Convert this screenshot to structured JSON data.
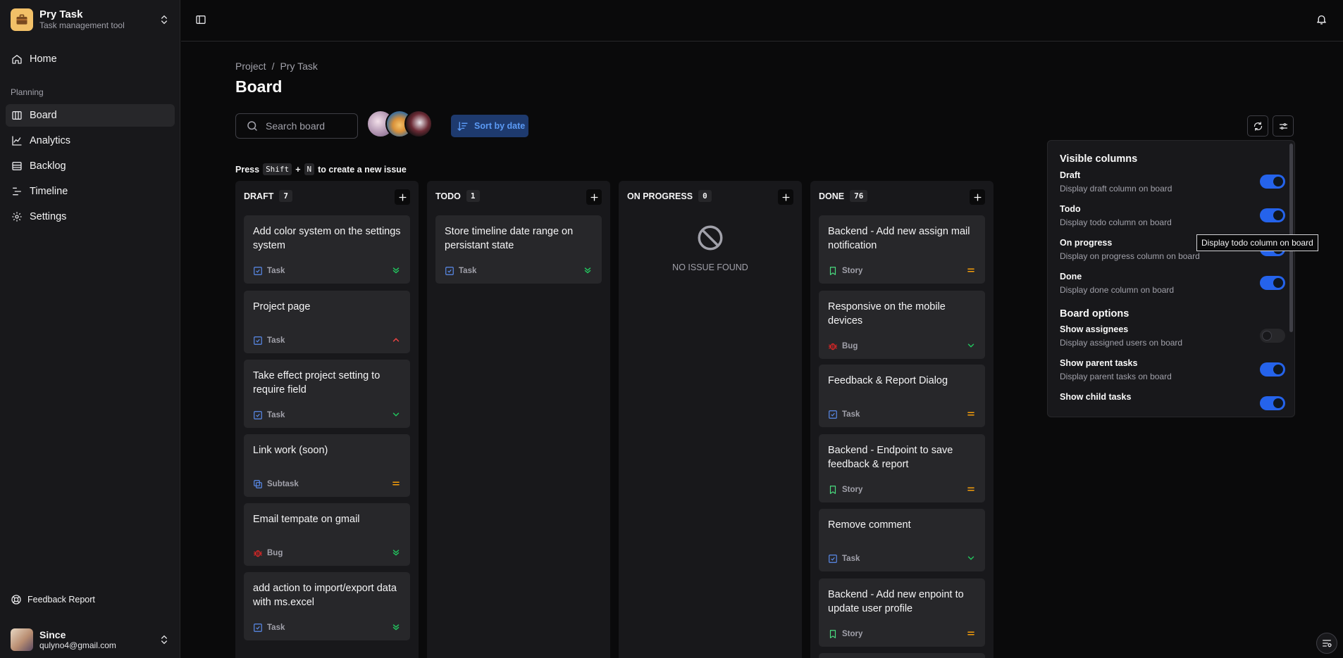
{
  "sidebar": {
    "brand": {
      "name": "Pry Task",
      "subtitle": "Task management tool"
    },
    "home": "Home",
    "section": "Planning",
    "items": [
      {
        "label": "Board",
        "icon": "board-icon",
        "active": true
      },
      {
        "label": "Analytics",
        "icon": "chart-icon"
      },
      {
        "label": "Backlog",
        "icon": "backlog-icon"
      },
      {
        "label": "Timeline",
        "icon": "timeline-icon"
      },
      {
        "label": "Settings",
        "icon": "gear-icon"
      }
    ],
    "feedback": "Feedback Report",
    "user": {
      "name": "Since",
      "email": "qulyno4@gmail.com"
    }
  },
  "breadcrumb": {
    "project": "Project",
    "separator": "/",
    "current": "Pry Task"
  },
  "page": {
    "title": "Board"
  },
  "search": {
    "placeholder": "Search board"
  },
  "sort": {
    "label": "Sort by date"
  },
  "hint": {
    "press": "Press",
    "key1": "Shift",
    "plus": "+",
    "key2": "N",
    "rest": "to create a new issue"
  },
  "columns": [
    {
      "title": "DRAFT",
      "count": "7",
      "cards": [
        {
          "title": "Add color system on the settings system",
          "type": "Task",
          "priority": "lowest"
        },
        {
          "title": "Project page",
          "type": "Task",
          "priority": "high"
        },
        {
          "title": "Take effect project setting to require field",
          "type": "Task",
          "priority": "low"
        },
        {
          "title": "Link work (soon)",
          "type": "Subtask",
          "priority": "medium"
        },
        {
          "title": "Email tempate on gmail",
          "type": "Bug",
          "priority": "lowest"
        },
        {
          "title": "add action to import/export data with ms.excel",
          "type": "Task",
          "priority": "lowest"
        }
      ]
    },
    {
      "title": "TODO",
      "count": "1",
      "cards": [
        {
          "title": "Store timeline date range on persistant state",
          "type": "Task",
          "priority": "lowest"
        }
      ]
    },
    {
      "title": "ON PROGRESS",
      "count": "0",
      "empty": "NO ISSUE FOUND",
      "cards": []
    },
    {
      "title": "DONE",
      "count": "76",
      "cards": [
        {
          "title": "Backend - Add new assign mail notification",
          "type": "Story",
          "priority": "medium"
        },
        {
          "title": "Responsive on the mobile devices",
          "type": "Bug",
          "priority": "low"
        },
        {
          "title": "Feedback & Report Dialog",
          "type": "Task",
          "priority": "medium"
        },
        {
          "title": "Backend - Endpoint to save feedback & report",
          "type": "Story",
          "priority": "medium"
        },
        {
          "title": "Remove comment",
          "type": "Task",
          "priority": "low"
        },
        {
          "title": "Backend - Add new enpoint to update user profile",
          "type": "Story",
          "priority": "medium"
        }
      ]
    }
  ],
  "popover": {
    "visible_heading": "Visible columns",
    "columns": [
      {
        "title": "Draft",
        "desc": "Display draft column on board",
        "on": true
      },
      {
        "title": "Todo",
        "desc": "Display todo column on board",
        "on": true
      },
      {
        "title": "On progress",
        "desc": "Display on progress column on board",
        "on": true
      },
      {
        "title": "Done",
        "desc": "Display done column on board",
        "on": true
      }
    ],
    "options_heading": "Board options",
    "options": [
      {
        "title": "Show assignees",
        "desc": "Display assigned users on board",
        "on": false
      },
      {
        "title": "Show parent tasks",
        "desc": "Display parent tasks on board",
        "on": true
      },
      {
        "title": "Show child tasks",
        "desc": "",
        "on": true
      }
    ]
  },
  "tooltip": "Display todo column on board",
  "colors": {
    "accent": "#2563eb",
    "task": "#5b8def",
    "story": "#4ade80",
    "bug": "#dc2626",
    "medium": "#f59e0b",
    "low": "#22c55e",
    "high": "#ef4444"
  }
}
